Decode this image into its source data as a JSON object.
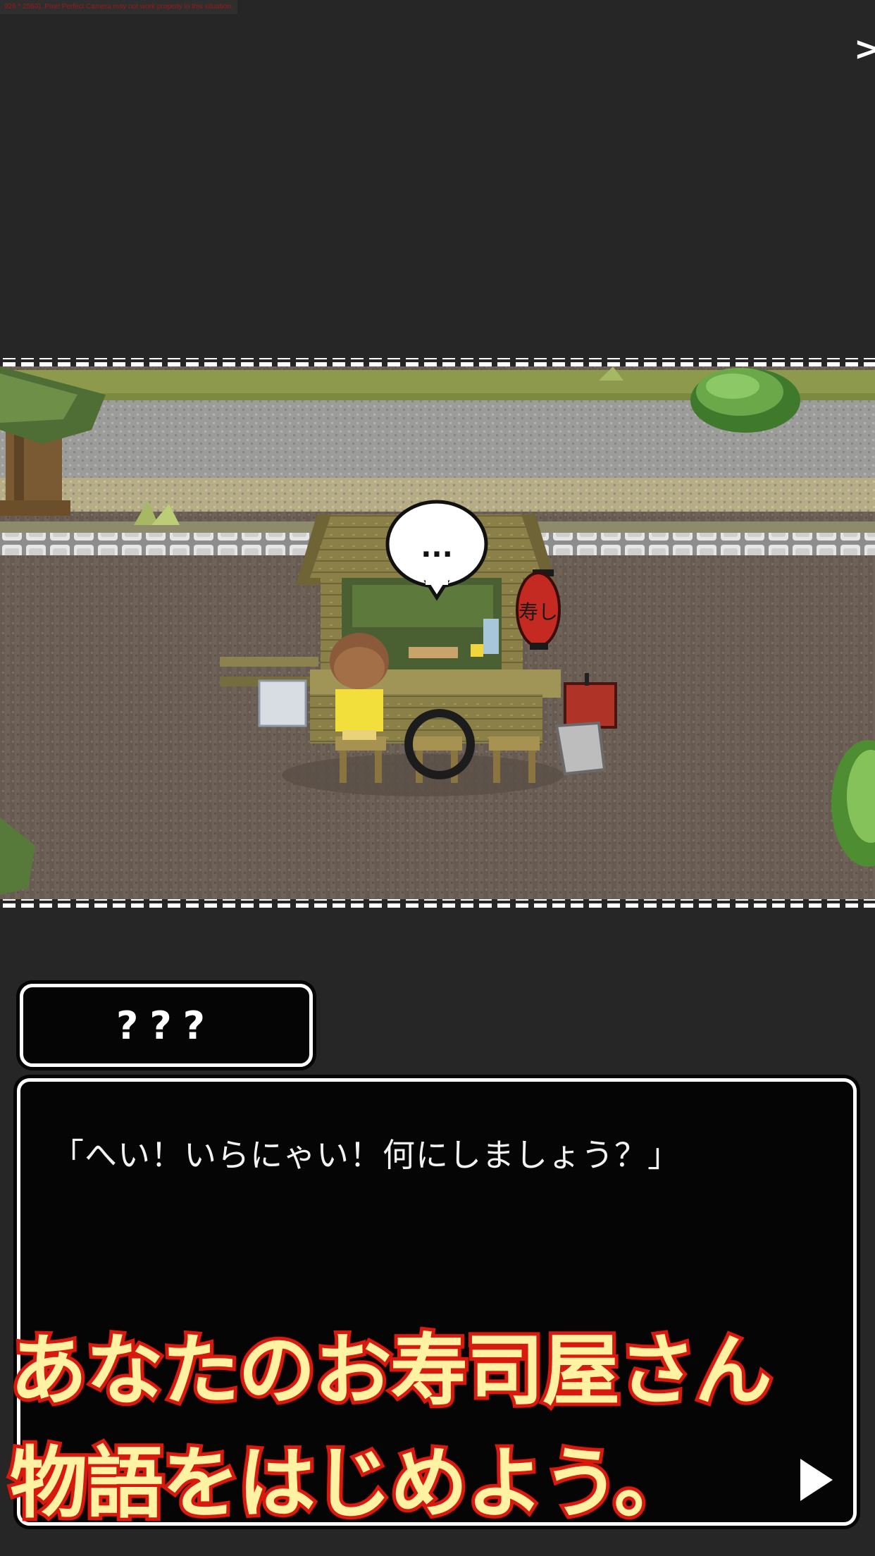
{
  "debug_text": "926 * 2560). Pixel Perfect Camera may not work properly in this situation.",
  "skip_label": ">",
  "scene": {
    "speech_bubble_text": "...",
    "lantern_text": "寿し"
  },
  "dialog": {
    "speaker": "???",
    "text": "「へい！いらにゃい！何にしましょう？」"
  },
  "caption": {
    "line1": "あなたのお寿司屋さん",
    "line2": "物語をはじめよう。"
  },
  "colors": {
    "background": "#262626",
    "caption_fill": "#fff3a3",
    "caption_stroke": "#d81b10",
    "dialog_bg": "#050505",
    "dialog_border": "#ffffff"
  }
}
